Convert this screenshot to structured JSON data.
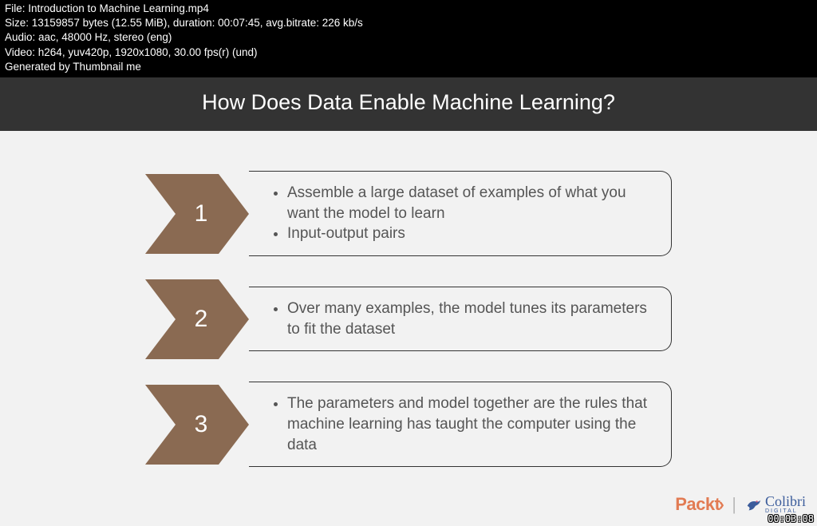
{
  "meta": {
    "line1": "File: Introduction to Machine Learning.mp4",
    "line2": "Size: 13159857 bytes (12.55 MiB), duration: 00:07:45, avg.bitrate: 226 kb/s",
    "line3": "Audio: aac, 48000 Hz, stereo (eng)",
    "line4": "Video: h264, yuv420p, 1920x1080, 30.00 fps(r) (und)",
    "line5": "Generated by Thumbnail me"
  },
  "slide": {
    "title": "How Does Data Enable Machine Learning?",
    "steps": [
      {
        "num": "1",
        "bullets": [
          "Assemble a large dataset of examples of what you want the model to learn",
          "Input-output pairs"
        ]
      },
      {
        "num": "2",
        "bullets": [
          "Over many examples, the model tunes its parameters to fit the dataset"
        ]
      },
      {
        "num": "3",
        "bullets": [
          "The parameters and model together are the rules that machine learning has taught the computer using the data"
        ]
      }
    ]
  },
  "brand": {
    "packt": "Packt",
    "packt_chevron": "›",
    "sep": "|",
    "colibri": "Colibri",
    "colibri_sub": "DIGITAL"
  },
  "timestamp": "00:03:08",
  "colors": {
    "arrow_fill": "#8a6a52"
  }
}
